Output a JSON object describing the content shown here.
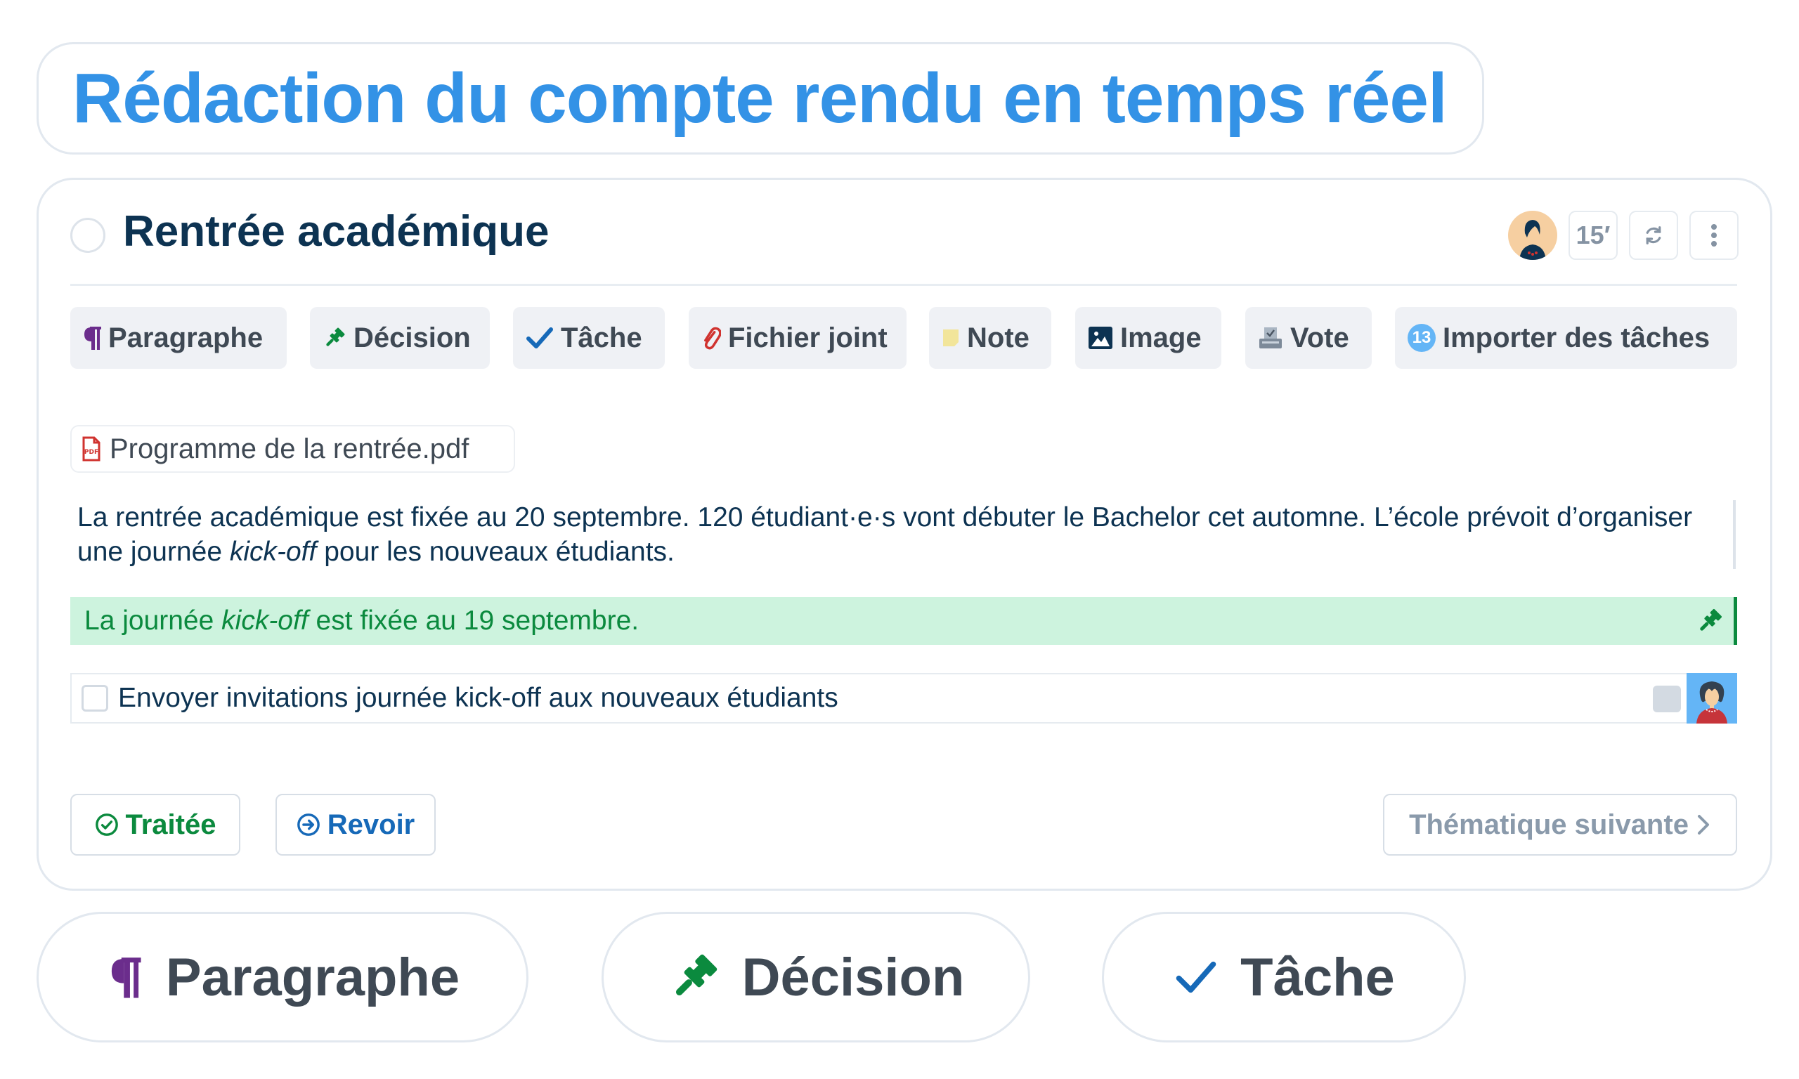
{
  "page_title": "Rédaction du compte rendu en temps réel",
  "topic": {
    "title": "Rentrée académique",
    "duration": "15′",
    "icons": {
      "status": "circle-status-icon",
      "avatar": "user-avatar",
      "refresh": "refresh-icon",
      "more": "more-vertical-icon"
    }
  },
  "toolbar": {
    "items": [
      {
        "label": "Paragraphe",
        "icon": "pilcrow-icon",
        "color": "#6b2d8c"
      },
      {
        "label": "Décision",
        "icon": "gavel-icon",
        "color": "#0b8a3e"
      },
      {
        "label": "Tâche",
        "icon": "check-icon",
        "color": "#1669b8"
      },
      {
        "label": "Fichier joint",
        "icon": "paperclip-icon",
        "color": "#d0332f"
      },
      {
        "label": "Note",
        "icon": "sticky-note-icon",
        "color": "#f2e59a"
      },
      {
        "label": "Image",
        "icon": "image-icon",
        "color": "#0d3352"
      },
      {
        "label": "Vote",
        "icon": "ballot-box-icon",
        "color": "#7d8a99"
      },
      {
        "label": "Importer des tâches",
        "icon": "count-badge",
        "badge": "13",
        "color": "#64b5f6"
      }
    ]
  },
  "attachment": {
    "filename": "Programme de la rentrée.pdf",
    "icon": "pdf-file-icon"
  },
  "paragraph": {
    "text_before": "La rentrée académique est fixée au 20 septembre. 120 étudiant·e·s vont débuter le Bachelor cet automne. L’école prévoit d’organiser une journée ",
    "text_italic": "kick-off",
    "text_after": " pour les nouveaux étudiants."
  },
  "decision": {
    "text_before": "La journée ",
    "text_italic": "kick-off",
    "text_after": " est fixée au 19 septembre.",
    "icon": "gavel-icon"
  },
  "task": {
    "text": "Envoyer invitations journée kick-off aux nouveaux étudiants",
    "checked": false
  },
  "actions": {
    "traitee": "Traitée",
    "revoir": "Revoir",
    "next": "Thématique suivante"
  },
  "legend_pills": [
    {
      "label": "Paragraphe",
      "icon": "pilcrow-icon"
    },
    {
      "label": "Décision",
      "icon": "gavel-icon"
    },
    {
      "label": "Tâche",
      "icon": "check-icon"
    }
  ],
  "colors": {
    "title_blue": "#3392e6",
    "navy": "#0d3352",
    "green": "#0b8a3e",
    "decision_bg": "#cdf3de",
    "blue": "#1669b8",
    "purple": "#6b2d8c",
    "muted": "#8a9aab"
  }
}
